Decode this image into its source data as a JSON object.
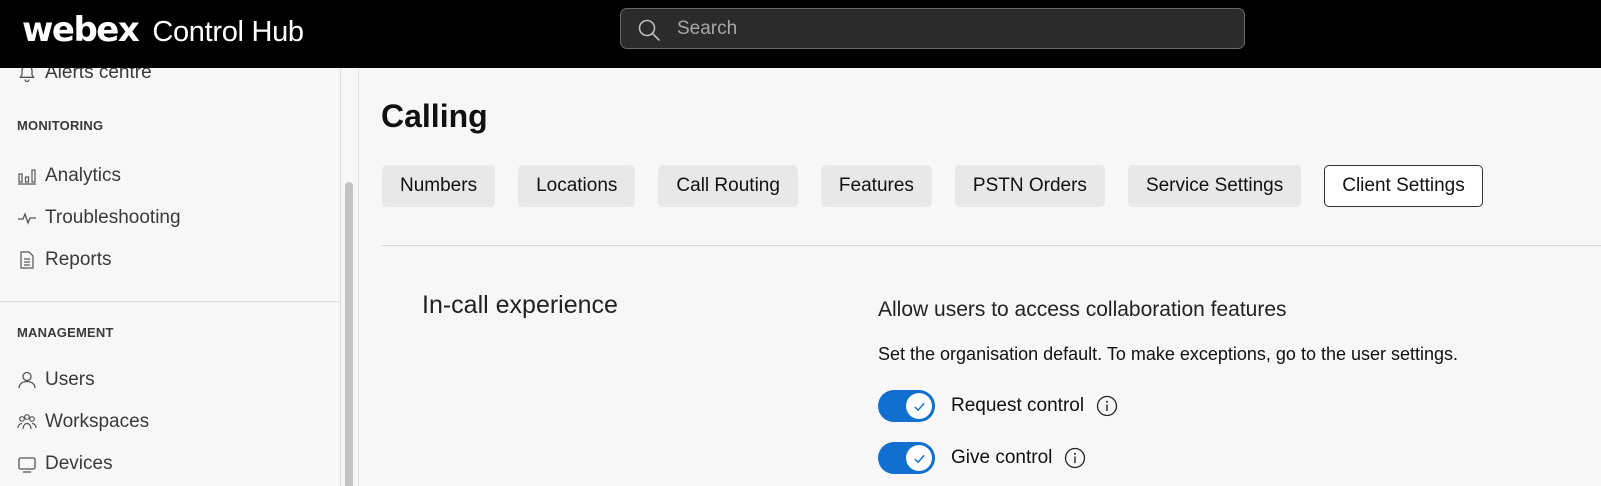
{
  "header": {
    "brand_logo": "webex",
    "brand_product": "Control Hub",
    "search_placeholder": "Search"
  },
  "sidebar": {
    "top_item": {
      "label": "Alerts centre",
      "icon": "bell-icon"
    },
    "monitoring": {
      "label": "MONITORING",
      "items": [
        {
          "label": "Analytics",
          "icon": "bar-chart-icon"
        },
        {
          "label": "Troubleshooting",
          "icon": "pulse-icon"
        },
        {
          "label": "Reports",
          "icon": "document-icon"
        }
      ]
    },
    "management": {
      "label": "MANAGEMENT",
      "items": [
        {
          "label": "Users",
          "icon": "user-icon"
        },
        {
          "label": "Workspaces",
          "icon": "people-group-icon"
        },
        {
          "label": "Devices",
          "icon": "device-icon"
        }
      ]
    }
  },
  "main": {
    "title": "Calling",
    "tabs": [
      {
        "label": "Numbers",
        "active": false
      },
      {
        "label": "Locations",
        "active": false
      },
      {
        "label": "Call Routing",
        "active": false
      },
      {
        "label": "Features",
        "active": false
      },
      {
        "label": "PSTN Orders",
        "active": false
      },
      {
        "label": "Service Settings",
        "active": false
      },
      {
        "label": "Client Settings",
        "active": true
      }
    ],
    "section_heading": "In-call experience",
    "collab": {
      "title": "Allow users to access collaboration features",
      "description": "Set the organisation default. To make exceptions, go to the user settings.",
      "toggles": [
        {
          "label": "Request control",
          "enabled": true
        },
        {
          "label": "Give control",
          "enabled": true
        }
      ]
    }
  },
  "colors": {
    "accent": "#1170cf",
    "topbar": "#000000",
    "background": "#f7f7f7"
  }
}
